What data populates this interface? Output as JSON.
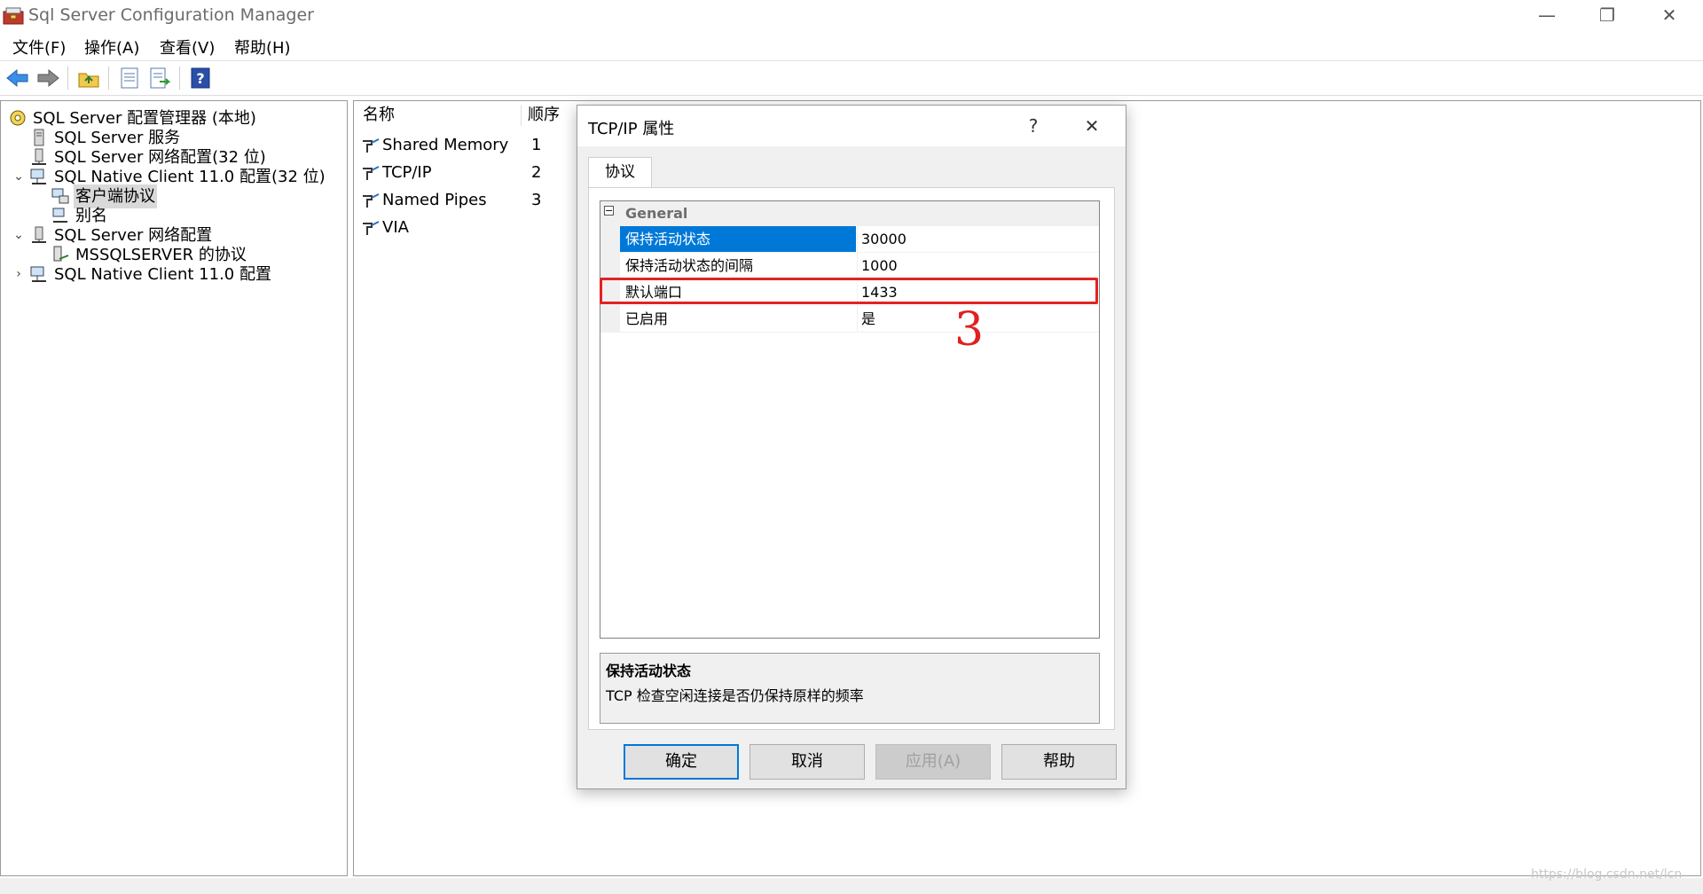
{
  "window": {
    "title": "Sql Server Configuration Manager",
    "minimize": "—",
    "restore": "❐",
    "close": "✕"
  },
  "menu": [
    "文件(F)",
    "操作(A)",
    "查看(V)",
    "帮助(H)"
  ],
  "toolbar": {
    "icons": [
      "back-arrow-icon",
      "forward-arrow-icon",
      "up-folder-icon",
      "properties-icon",
      "export-list-icon",
      "help-icon"
    ]
  },
  "tree": [
    {
      "label": "SQL Server 配置管理器 (本地)",
      "icon": "config-manager-icon",
      "level": 0,
      "expander": ""
    },
    {
      "label": "SQL Server 服务",
      "icon": "services-icon",
      "level": 1,
      "expander": ""
    },
    {
      "label": "SQL Server 网络配置(32 位)",
      "icon": "network-config-icon",
      "level": 1,
      "expander": ""
    },
    {
      "label": "SQL Native Client 11.0 配置(32 位)",
      "icon": "native-client-icon",
      "level": 1,
      "expander": "⌄"
    },
    {
      "label": "客户端协议",
      "icon": "client-protocol-icon",
      "level": 2,
      "expander": "",
      "selected": true
    },
    {
      "label": "别名",
      "icon": "alias-icon",
      "level": 2,
      "expander": ""
    },
    {
      "label": "SQL Server 网络配置",
      "icon": "network-config-icon",
      "level": 1,
      "expander": "⌄"
    },
    {
      "label": "MSSQLSERVER 的协议",
      "icon": "protocol-icon",
      "level": 2,
      "expander": ""
    },
    {
      "label": "SQL Native Client 11.0 配置",
      "icon": "native-client-icon",
      "level": 1,
      "expander": "›"
    }
  ],
  "list": {
    "columns": [
      "名称",
      "顺序"
    ],
    "rows": [
      {
        "name": "Shared Memory",
        "order": "1"
      },
      {
        "name": "TCP/IP",
        "order": "2"
      },
      {
        "name": "Named Pipes",
        "order": "3"
      },
      {
        "name": "VIA",
        "order": ""
      }
    ]
  },
  "dialog": {
    "title": "TCP/IP 属性",
    "help_glyph": "?",
    "close_glyph": "✕",
    "tab": "协议",
    "category": "General",
    "collapse_glyph": "−",
    "properties": [
      {
        "name": "保持活动状态",
        "value": "30000",
        "selected": true
      },
      {
        "name": "保持活动状态的间隔",
        "value": "1000"
      },
      {
        "name": "默认端口",
        "value": "1433"
      },
      {
        "name": "已启用",
        "value": "是"
      }
    ],
    "description_title": "保持活动状态",
    "description_text": "TCP 检查空闲连接是否仍保持原样的频率",
    "buttons": {
      "ok": "确定",
      "cancel": "取消",
      "apply": "应用(A)",
      "help": "帮助"
    }
  },
  "annotation": "3",
  "watermark": "https://blog.csdn.net/lcn"
}
